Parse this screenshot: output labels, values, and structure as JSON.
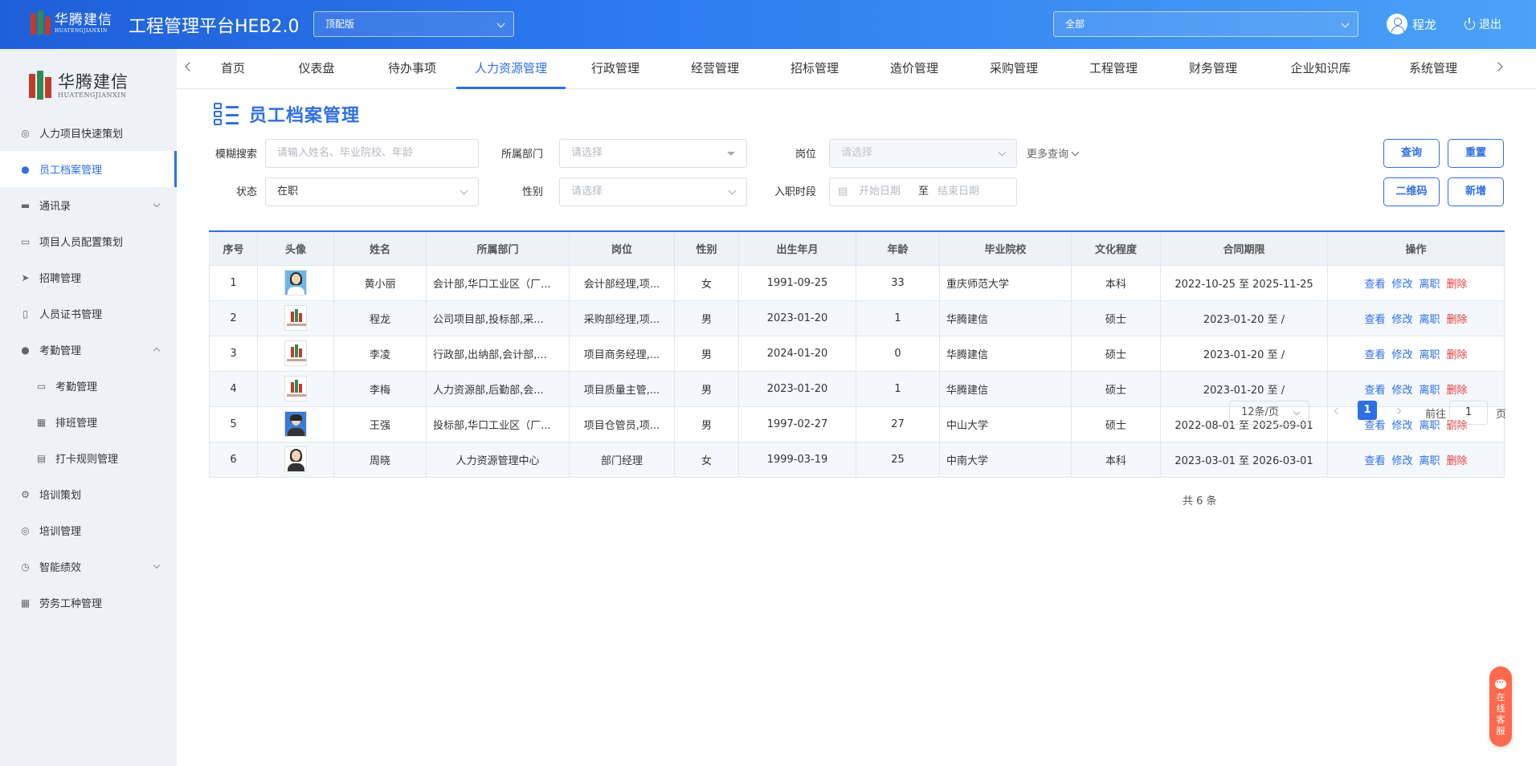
{
  "brand": {
    "logo_cn": "华腾建信",
    "logo_en": "HUATENGJIANXIN",
    "app_title": "工程管理平台HEB2.0"
  },
  "header": {
    "version_select": "顶配版",
    "scope_select": "全部",
    "user_name": "程龙",
    "logout_label": "退出"
  },
  "sidebar": {
    "items": [
      {
        "label": "人力项目快速策划",
        "icon": "check-circle-icon"
      },
      {
        "label": "员工档案管理",
        "icon": "user-icon"
      },
      {
        "label": "通讯录",
        "icon": "briefcase-icon"
      },
      {
        "label": "项目人员配置策划",
        "icon": "monitor-icon"
      },
      {
        "label": "招聘管理",
        "icon": "send-icon"
      },
      {
        "label": "人员证书管理",
        "icon": "book-icon"
      },
      {
        "label": "考勤管理",
        "icon": "users-icon"
      },
      {
        "label": "考勤管理",
        "icon": "folder-icon"
      },
      {
        "label": "排班管理",
        "icon": "grid-icon"
      },
      {
        "label": "打卡规则管理",
        "icon": "calendar-icon"
      },
      {
        "label": "培训策划",
        "icon": "gear-icon"
      },
      {
        "label": "培训管理",
        "icon": "target-icon"
      },
      {
        "label": "智能绩效",
        "icon": "timer-icon"
      },
      {
        "label": "劳务工种管理",
        "icon": "apps-icon"
      }
    ]
  },
  "topnav": {
    "tabs": [
      "首页",
      "仪表盘",
      "待办事项",
      "人力资源管理",
      "行政管理",
      "经营管理",
      "招标管理",
      "造价管理",
      "采购管理",
      "工程管理",
      "财务管理",
      "企业知识库",
      "系统管理"
    ]
  },
  "page": {
    "title": "员工档案管理"
  },
  "filters": {
    "fuzzy_label": "模糊搜索",
    "fuzzy_placeholder": "请输入姓名、毕业院校、年龄",
    "dept_label": "所属部门",
    "dept_placeholder": "请选择",
    "post_label": "岗位",
    "post_placeholder": "请选择",
    "more_query": "更多查询",
    "status_label": "状态",
    "status_value": "在职",
    "gender_label": "性别",
    "gender_placeholder": "请选择",
    "join_label": "入职时段",
    "start_placeholder": "开始日期",
    "range_sep": "至",
    "end_placeholder": "结束日期"
  },
  "buttons": {
    "query": "查询",
    "reset": "重置",
    "qrcode": "二维码",
    "add": "新增"
  },
  "table": {
    "headers": [
      "序号",
      "头像",
      "姓名",
      "所属部门",
      "岗位",
      "性别",
      "出生年月",
      "年龄",
      "毕业院校",
      "文化程度",
      "合同期限",
      "操作"
    ],
    "actions": {
      "view": "查看",
      "edit": "修改",
      "leave": "离职",
      "delete": "删除"
    },
    "rows": [
      {
        "no": "1",
        "avatar": "female-photo",
        "name": "黄小丽",
        "dept": "会计部,华口工业区（厂...",
        "post": "会计部经理,项...",
        "gender": "女",
        "birth": "1991-09-25",
        "age": "33",
        "school": "重庆师范大学",
        "edu": "本科",
        "contract": "2022-10-25 至 2025-11-25"
      },
      {
        "no": "2",
        "avatar": "company-logo",
        "name": "程龙",
        "dept": "公司项目部,投标部,采...",
        "post": "采购部经理,项...",
        "gender": "男",
        "birth": "2023-01-20",
        "age": "1",
        "school": "华腾建信",
        "edu": "硕士",
        "contract": "2023-01-20 至 /"
      },
      {
        "no": "3",
        "avatar": "company-logo",
        "name": "李凌",
        "dept": "行政部,出纳部,会计部,...",
        "post": "项目商务经理,...",
        "gender": "男",
        "birth": "2024-01-20",
        "age": "0",
        "school": "华腾建信",
        "edu": "硕士",
        "contract": "2023-01-20 至 /"
      },
      {
        "no": "4",
        "avatar": "company-logo",
        "name": "李梅",
        "dept": "人力资源部,后勤部,会...",
        "post": "项目质量主管,...",
        "gender": "男",
        "birth": "2023-01-20",
        "age": "1",
        "school": "华腾建信",
        "edu": "硕士",
        "contract": "2023-01-20 至 /"
      },
      {
        "no": "5",
        "avatar": "male-photo",
        "name": "王强",
        "dept": "投标部,华口工业区（厂...",
        "post": "项目仓管员,项...",
        "gender": "男",
        "birth": "1997-02-27",
        "age": "27",
        "school": "中山大学",
        "edu": "硕士",
        "contract": "2022-08-01 至 2025-09-01"
      },
      {
        "no": "6",
        "avatar": "female-photo-white",
        "name": "周晓",
        "dept": "人力资源管理中心",
        "post": "部门经理",
        "gender": "女",
        "birth": "1999-03-19",
        "age": "25",
        "school": "中南大学",
        "edu": "本科",
        "contract": "2023-03-01 至 2026-03-01"
      }
    ]
  },
  "pagination": {
    "total_text": "共 6 条",
    "page_size": "12条/页",
    "current_page": "1",
    "goto_prefix": "前往",
    "goto_value": "1",
    "goto_suffix": "页"
  },
  "service": {
    "label": "在线客服"
  },
  "colors": {
    "primary": "#2f6fe4",
    "danger": "#e03e3e",
    "header_gradient_start": "#1e5fd8",
    "header_gradient_end": "#4aa3f7"
  }
}
